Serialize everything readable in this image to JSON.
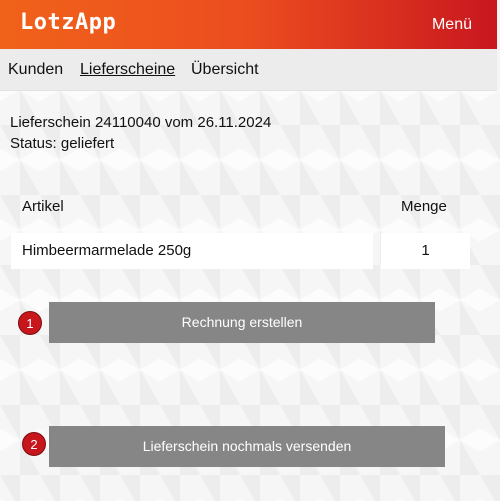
{
  "header": {
    "title": "LotzApp",
    "menu_label": "Menü"
  },
  "nav": {
    "items": [
      {
        "label": "Kunden"
      },
      {
        "label": "Lieferscheine",
        "active": true
      },
      {
        "label": "Übersicht"
      }
    ]
  },
  "delivery": {
    "title_line": "Lieferschein 24110040 vom 26.11.2024",
    "status_line": "Status: geliefert"
  },
  "table": {
    "headers": {
      "article": "Artikel",
      "quantity": "Menge"
    },
    "rows": [
      {
        "article": "Himbeermarmelade 250g",
        "quantity": "1"
      }
    ]
  },
  "actions": {
    "create_invoice": {
      "badge": "1",
      "label": "Rechnung erstellen"
    },
    "resend": {
      "badge": "2",
      "label": "Lieferschein nochmals versenden"
    }
  },
  "colors": {
    "header_start": "#f0621a",
    "header_end": "#c9171f",
    "button": "#868686",
    "badge": "#c8161d"
  }
}
